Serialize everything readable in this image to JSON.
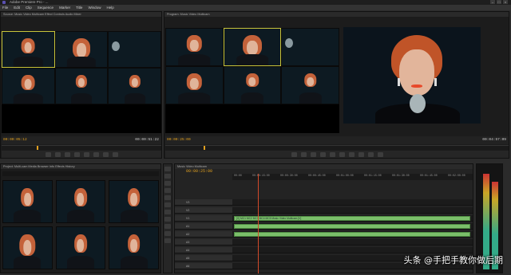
{
  "app": {
    "title": "Adobe Premiere Pro - ...",
    "window_buttons": [
      "–",
      "□",
      "×"
    ]
  },
  "menu": [
    "File",
    "Edit",
    "Clip",
    "Sequence",
    "Marker",
    "Title",
    "Window",
    "Help"
  ],
  "source_monitor": {
    "tabs": "Source: Music Video Multicam  Effect Controls  Audio Mixer",
    "timecode_left": "00:00:05:12",
    "timecode_right": "00:00:51:22"
  },
  "program_monitor": {
    "tabs": "Program: Music Video Multicam",
    "timecode_left": "00:00:25:00",
    "timecode_right": "00:04:57:09"
  },
  "project_panel": {
    "tabs": "Project: Multi-cam  Media Browser  Info  Effects  History"
  },
  "timeline": {
    "tab": "Music Video Multicam",
    "timecode": "00:00:25:00",
    "ruler": [
      "00:00",
      "00:00:15:00",
      "00:00:30:00",
      "00:00:45:00",
      "00:01:00:00",
      "00:01:15:00",
      "00:01:30:00",
      "00:01:45:00",
      "00:02:00:00"
    ],
    "tracks": [
      "V3",
      "V2",
      "V1",
      "A1",
      "A2",
      "A3",
      "A4",
      "A5",
      "A6"
    ],
    "clip_label": "[V] MC1  MC2  MC3  MC4  MC5  Music Video Multicam [V]"
  },
  "watermark": "头条 @手把手教你做后期",
  "colors": {
    "accent_timecode": "#e0a020",
    "clip_green": "#7bbf6a",
    "playhead": "#d24a2a",
    "selected_border": "#c8c43a"
  }
}
